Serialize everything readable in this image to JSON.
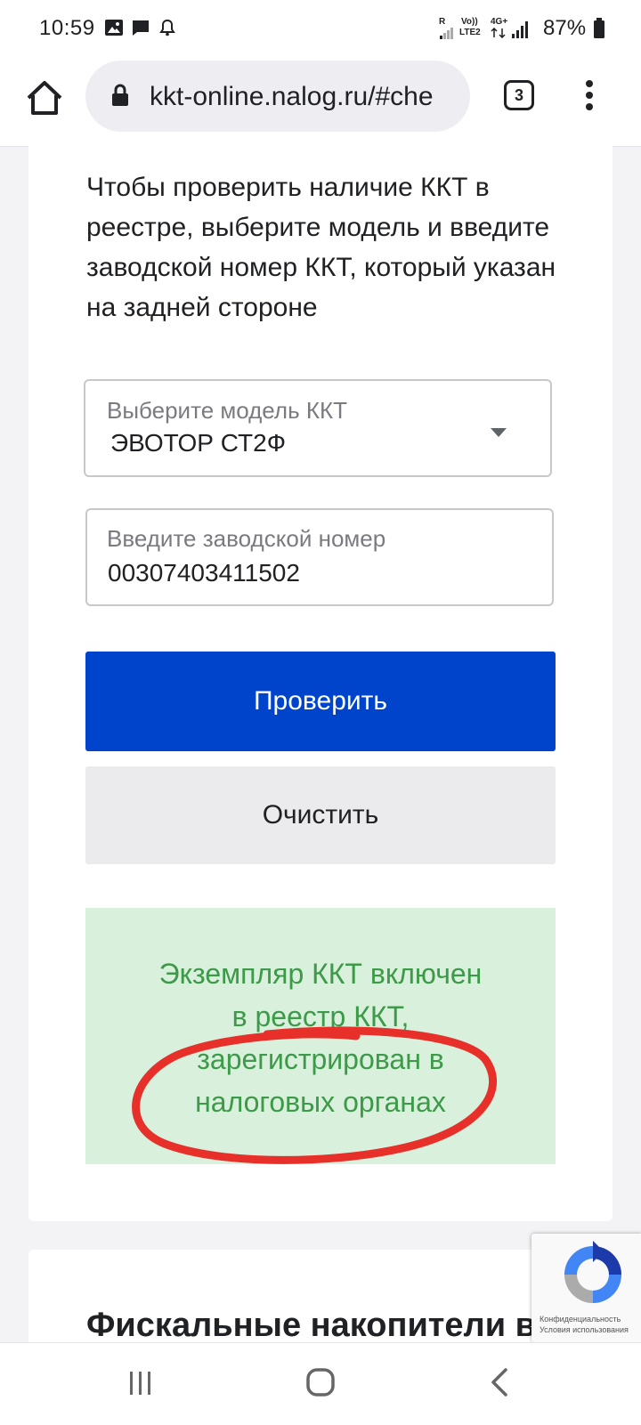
{
  "status_bar": {
    "time": "10:59",
    "battery": "87%",
    "sim1": "R",
    "volte": "Vo))",
    "lte": "LTE2",
    "net": "4G+"
  },
  "browser": {
    "url": "kkt-online.nalog.ru/#che",
    "tab_count": "3"
  },
  "page": {
    "intro": "Чтобы проверить наличие ККТ в реестре, выберите модель и введите заводской номер ККТ, который указан на задней стороне",
    "model_select": {
      "label": "Выберите модель ККТ",
      "value": "ЭВОТОР СТ2Ф"
    },
    "serial_input": {
      "label": "Введите заводской номер",
      "value": "00307403411502"
    },
    "check_button": "Проверить",
    "clear_button": "Очистить",
    "result": {
      "line1": "Экземпляр ККТ включен",
      "line2": "в реестр ККТ,",
      "line3": "зарегистрирован в",
      "line4": "налоговых органах"
    },
    "next_section_title": "Фискальные накопители в"
  },
  "recaptcha": {
    "privacy": "Конфиденциальность",
    "terms": "Условия использования"
  },
  "colors": {
    "primary": "#0044cc",
    "result_bg": "#d9f0dc",
    "result_text": "#3c9a48",
    "annotation": "#e8302a"
  }
}
